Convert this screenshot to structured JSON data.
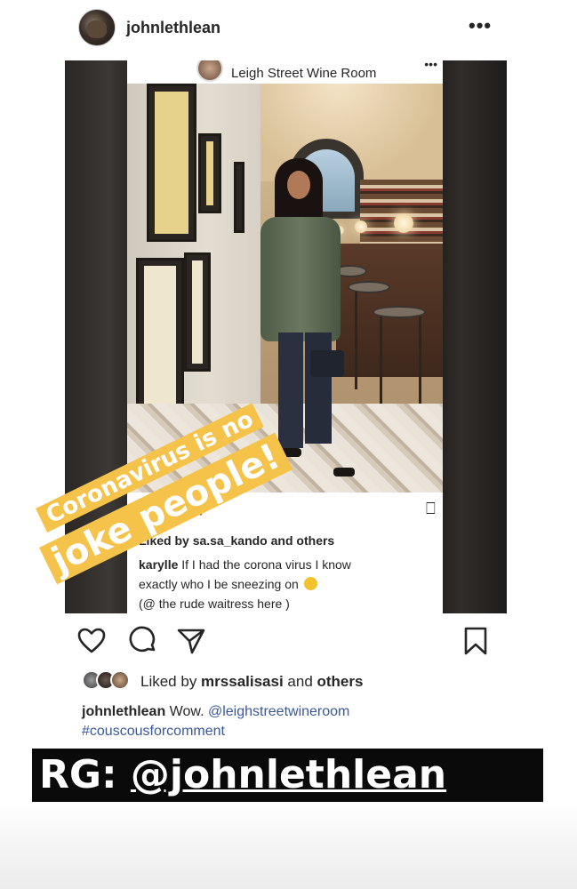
{
  "header": {
    "username": "johnlethlean",
    "more_icon": "•••"
  },
  "inner_post": {
    "location": "Leigh Street Wine Room",
    "likes_prefix": "Liked by ",
    "likes_user": "sa.sa_kando",
    "likes_suffix": " and ",
    "likes_others": "others",
    "comment_user": "karylle",
    "comment_line1": " If I had the corona virus I know",
    "comment_line2": "exactly who I be sneezing on ",
    "comment_line3": "(@ the rude waitress here )"
  },
  "sticker": {
    "line1": "Coronavirus is no",
    "line2": "joke people!"
  },
  "post": {
    "likes_prefix": "Liked by ",
    "likes_user": "mrssalisasi",
    "likes_suffix": " and ",
    "likes_others": "others",
    "caption_user": "johnlethlean",
    "caption_text": " Wow. ",
    "caption_mention": "@leighstreetwineroom",
    "caption_hashtag": "#couscousforcomment"
  },
  "banner": {
    "prefix": "RG: ",
    "handle": "@johnlethlean"
  },
  "colors": {
    "sticker": "#f5c24a",
    "banner": "#0a0a0a",
    "link": "#3b5998"
  }
}
